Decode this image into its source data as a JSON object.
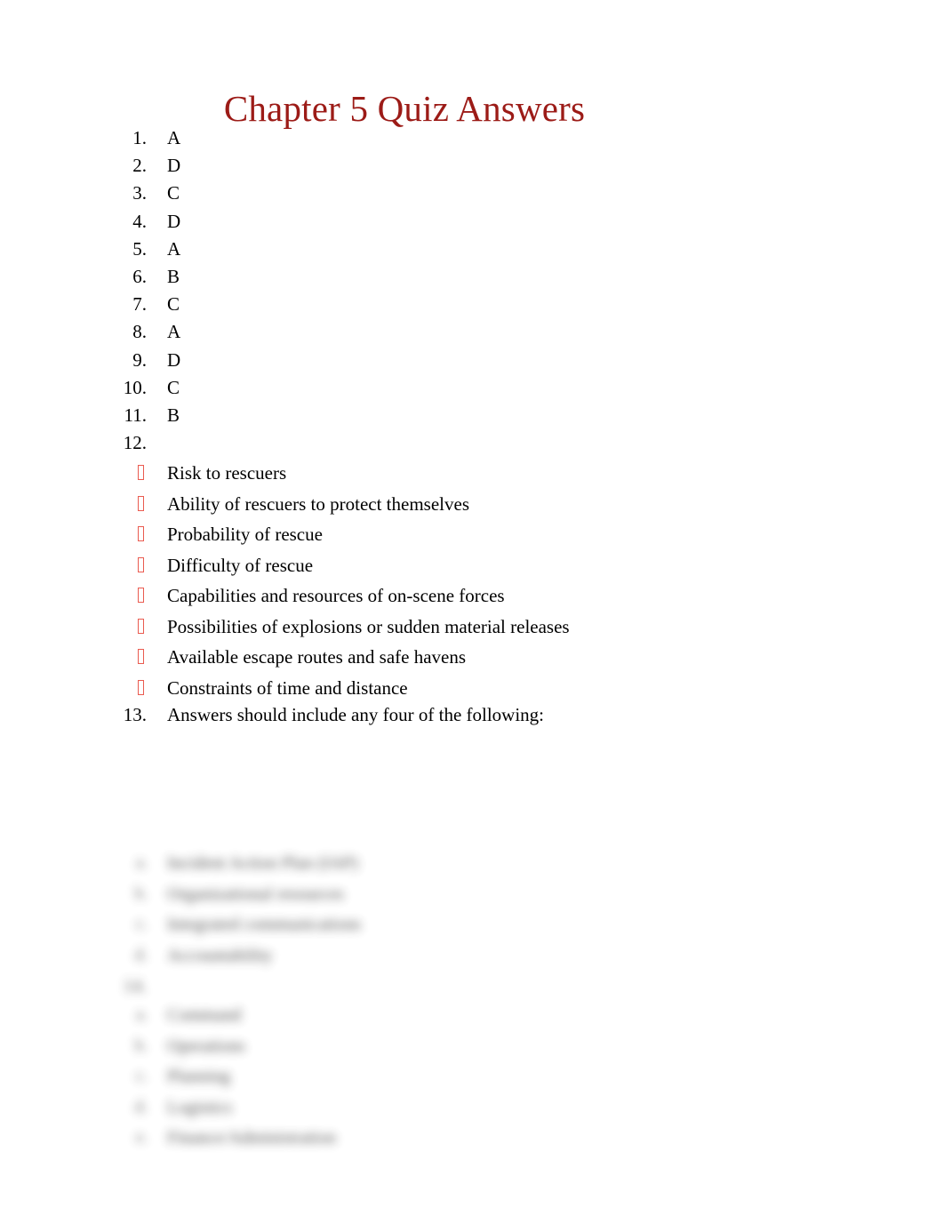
{
  "document": {
    "title": "Chapter 5 Quiz Answers",
    "title_color": "#9C1B17",
    "bullet_color": "#EA5B50",
    "page_background": "#ffffff",
    "body_text_color": "#000000"
  },
  "multiple_choice": [
    {
      "number": "1.",
      "answer": "A"
    },
    {
      "number": "2.",
      "answer": "D"
    },
    {
      "number": "3.",
      "answer": "C"
    },
    {
      "number": "4.",
      "answer": "D"
    },
    {
      "number": "5.",
      "answer": "A"
    },
    {
      "number": "6.",
      "answer": "B"
    },
    {
      "number": "7.",
      "answer": "C"
    },
    {
      "number": "8.",
      "answer": "A"
    },
    {
      "number": "9.",
      "answer": "D"
    },
    {
      "number": "10.",
      "answer": "C"
    },
    {
      "number": "11.",
      "answer": "B"
    }
  ],
  "question_12": {
    "number": "12.",
    "text": "",
    "bullet_glyph": "tofu-box",
    "bullets": [
      "Risk to rescuers",
      "Ability of rescuers to protect themselves",
      "Probability of rescue",
      "Difficulty of rescue",
      "Capabilities and resources of on-scene forces",
      "Possibilities of explosions or sudden material releases",
      "Available escape routes and safe havens",
      "Constraints of time and distance"
    ]
  },
  "question_13": {
    "number": "13.",
    "text": "Answers should include any four of the following:",
    "sub_items": [
      {
        "marker": "a.",
        "text": "Incident Action Plan (IAP)"
      },
      {
        "marker": "b.",
        "text": "Organizational resources"
      },
      {
        "marker": "c.",
        "text": "Integrated communications"
      },
      {
        "marker": "d.",
        "text": "Accountability"
      }
    ]
  },
  "question_14": {
    "number": "14.",
    "text": "",
    "sub_items": [
      {
        "marker": "a.",
        "text": "Command"
      },
      {
        "marker": "b.",
        "text": "Operations"
      },
      {
        "marker": "c.",
        "text": "Planning"
      },
      {
        "marker": "d.",
        "text": "Logistics"
      },
      {
        "marker": "e.",
        "text": "Finance/Administration"
      }
    ]
  }
}
